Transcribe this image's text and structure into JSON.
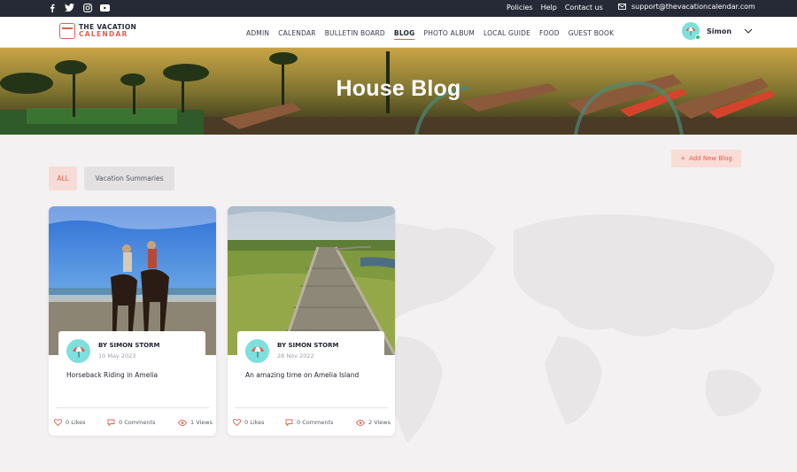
{
  "topbar": {
    "social": [
      {
        "icon": "facebook-icon"
      },
      {
        "icon": "twitter-icon"
      },
      {
        "icon": "instagram-icon"
      },
      {
        "icon": "youtube-icon"
      }
    ],
    "links": [
      "Policies",
      "Help",
      "Contact us"
    ],
    "email": "support@thevacationcalendar.com"
  },
  "brand": {
    "line1": "THE VACATION",
    "line2": "CALENDAR"
  },
  "nav": {
    "items": [
      "ADMIN",
      "CALENDAR",
      "BULLETIN BOARD",
      "BLOG",
      "PHOTO ALBUM",
      "LOCAL GUIDE",
      "FOOD",
      "GUEST BOOK"
    ],
    "active": "BLOG"
  },
  "user": {
    "name": "Simon"
  },
  "hero": {
    "title": "House Blog"
  },
  "filters": {
    "all": "ALL",
    "vacation": "Vacation Summaries"
  },
  "add_button": {
    "label": "Add New Blog"
  },
  "posts": [
    {
      "author": "BY SIMON STORM",
      "date": "10 May 2023",
      "title": "Horseback Riding in Amelia",
      "likes": "0 Likes",
      "comments": "0 Comments",
      "views": "1 Views"
    },
    {
      "author": "BY SIMON STORM",
      "date": "28 Nov 2022",
      "title": "An amazing time on Amelia Island",
      "likes": "0 Likes",
      "comments": "0 Comments",
      "views": "2 Views"
    }
  ],
  "colors": {
    "accent": "#e0604f",
    "dark": "#262a36",
    "avatar": "#7de0dc"
  }
}
